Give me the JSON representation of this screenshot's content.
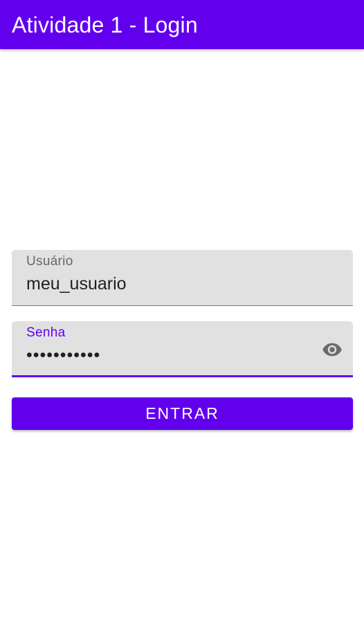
{
  "app_bar": {
    "title": "Atividade 1 - Login",
    "color": "#6200EE"
  },
  "form": {
    "username": {
      "label": "Usuário",
      "value": "meu_usuario"
    },
    "password": {
      "label": "Senha",
      "masked_value": "•••••••••••",
      "toggle_icon": "eye-icon"
    },
    "submit_label": "ENTRAR"
  },
  "colors": {
    "primary": "#6200EE",
    "field_background": "#E1E1E1"
  }
}
